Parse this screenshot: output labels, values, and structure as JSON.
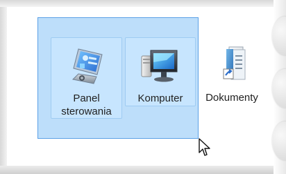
{
  "desktop": {
    "items": [
      {
        "label": "Panel\nsterowania",
        "icon": "control-panel-icon"
      },
      {
        "label": "Komputer",
        "icon": "computer-icon"
      },
      {
        "label": "Dokumenty",
        "icon": "documents-shortcut-icon"
      }
    ]
  }
}
